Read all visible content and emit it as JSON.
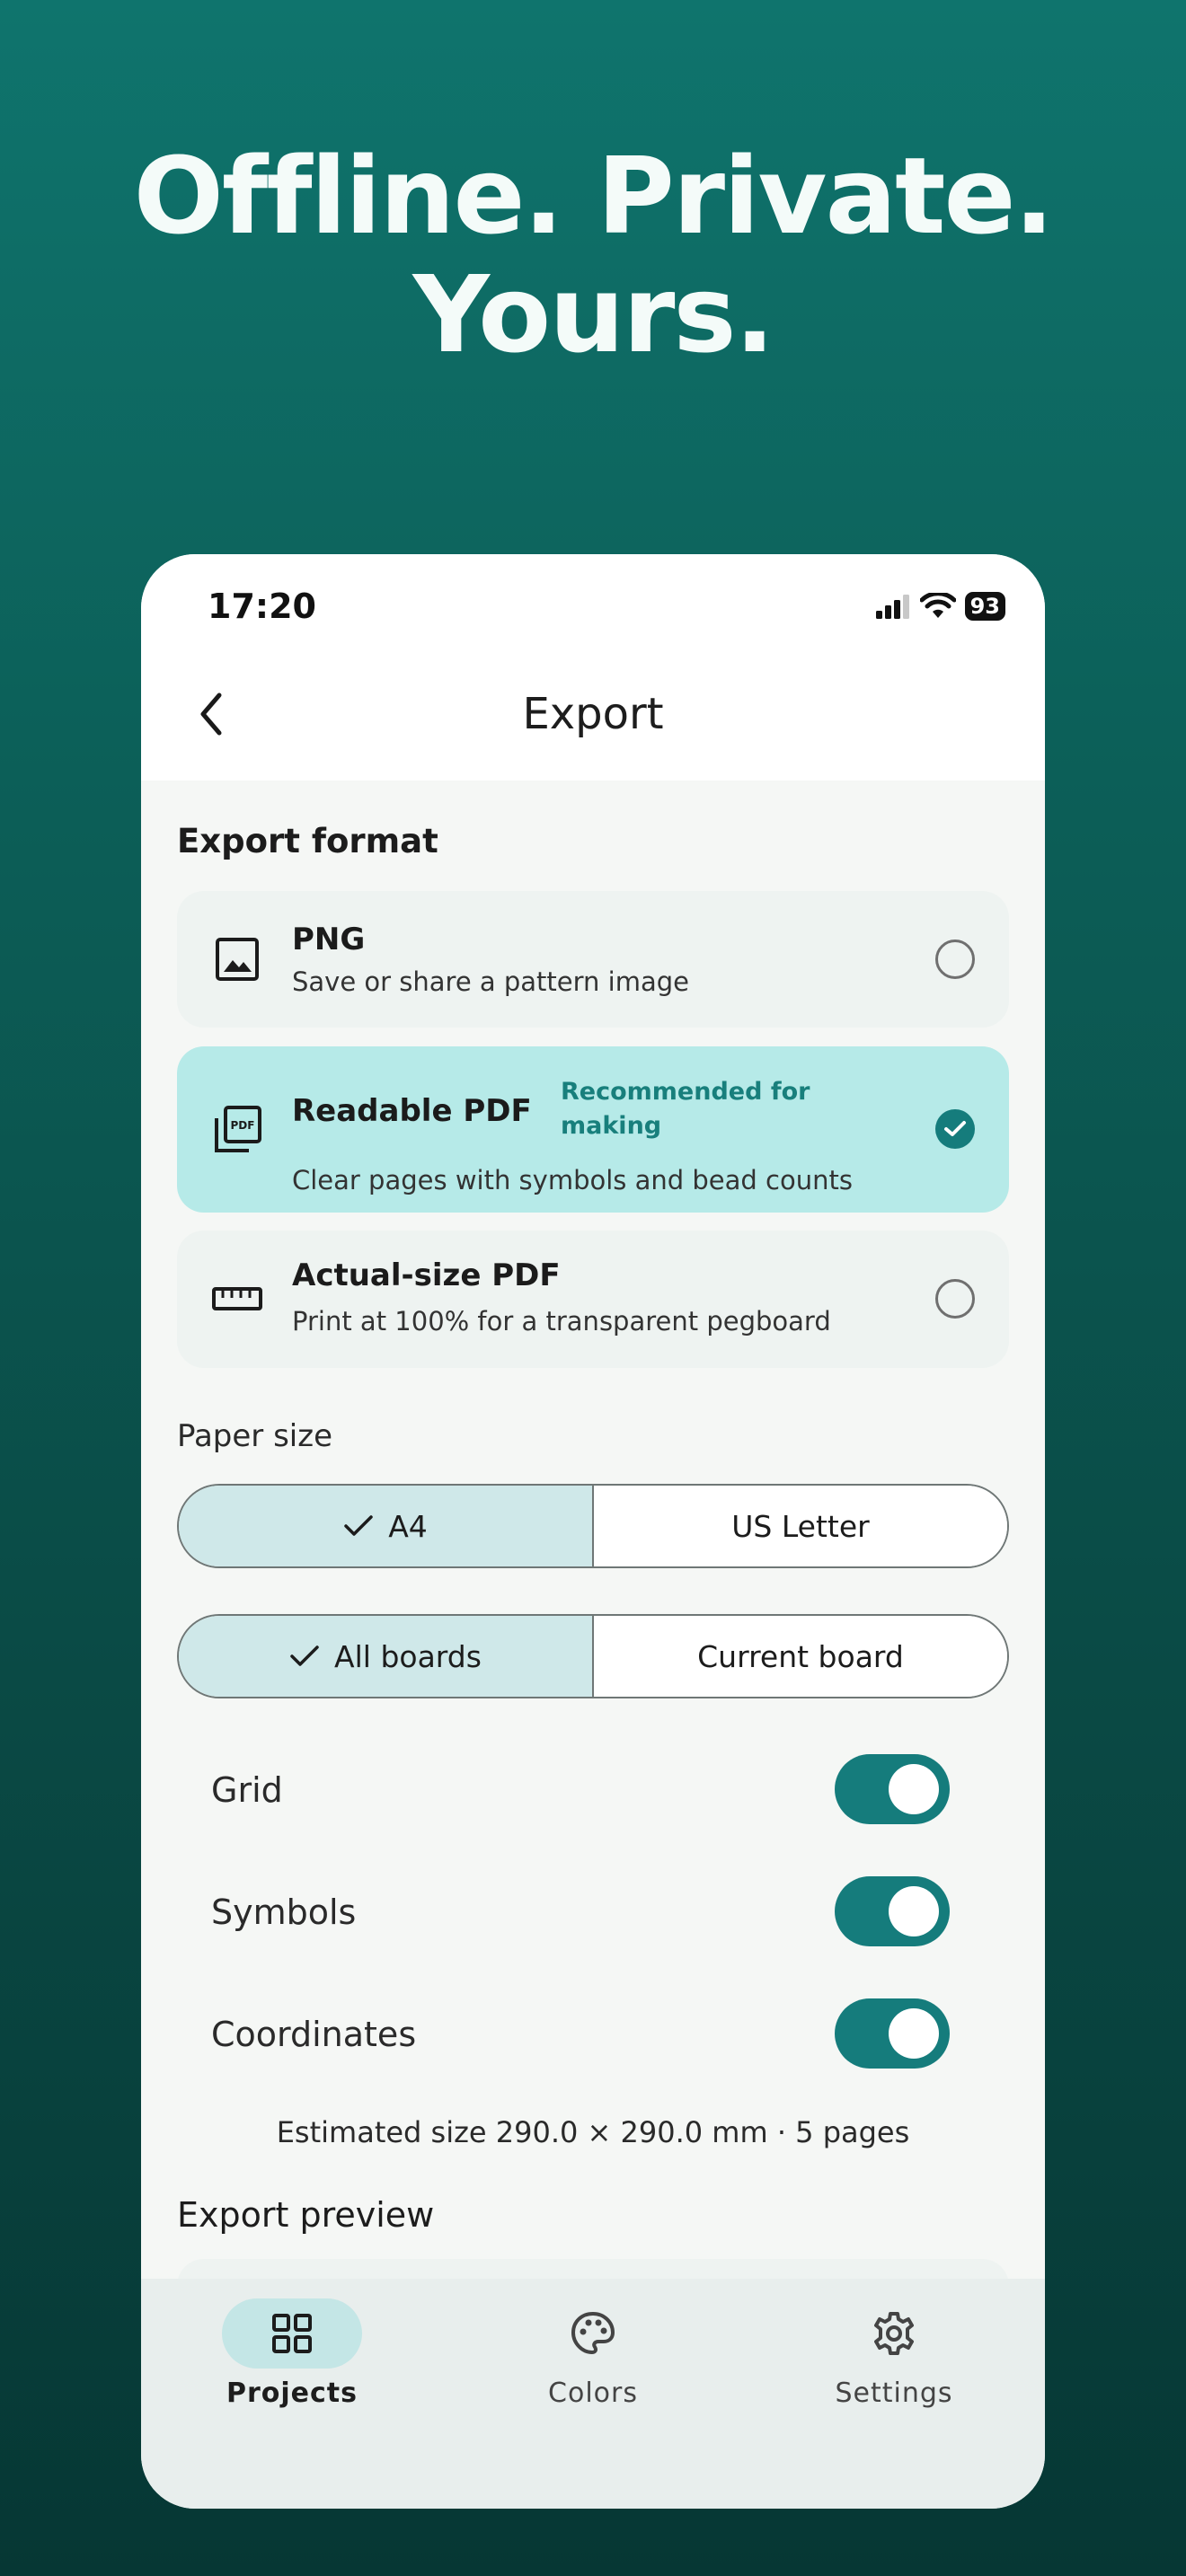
{
  "headline": {
    "line1": "Offline. Private.",
    "line2": "Yours."
  },
  "status": {
    "time": "17:20",
    "battery": "93"
  },
  "nav": {
    "title": "Export"
  },
  "export_format": {
    "section_title": "Export format",
    "options": [
      {
        "title": "PNG",
        "subtitle": "Save or share a pattern image",
        "selected": false
      },
      {
        "title": "Readable PDF",
        "badge_line1": "Recommended for",
        "badge_line2": "making",
        "subtitle": "Clear pages with symbols and bead counts",
        "selected": true
      },
      {
        "title": "Actual-size PDF",
        "subtitle": "Print at 100% for a transparent pegboard",
        "selected": false
      }
    ]
  },
  "paper_size": {
    "label": "Paper size",
    "options": [
      "A4",
      "US Letter"
    ],
    "selected": "A4"
  },
  "boards": {
    "options": [
      "All boards",
      "Current board"
    ],
    "selected": "All boards"
  },
  "toggles": [
    {
      "label": "Grid",
      "on": true
    },
    {
      "label": "Symbols",
      "on": true
    },
    {
      "label": "Coordinates",
      "on": true
    }
  ],
  "estimate": "Estimated size 290.0 × 290.0 mm · 5 pages",
  "preview": {
    "section_title": "Export preview"
  },
  "tabs": [
    {
      "label": "Projects",
      "active": true
    },
    {
      "label": "Colors",
      "active": false
    },
    {
      "label": "Settings",
      "active": false
    }
  ],
  "colors": {
    "accent": "#157c7c",
    "selected_card": "#b6eae8",
    "segment_active": "#cfe8e9",
    "background_top": "#0f746d",
    "background_bottom": "#063734"
  }
}
